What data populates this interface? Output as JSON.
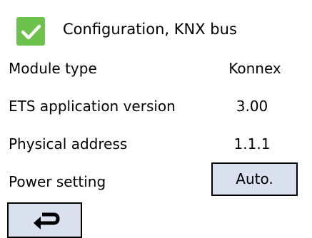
{
  "header": {
    "status_icon": "green-check-icon",
    "title": "Configuration, KNX bus"
  },
  "rows": [
    {
      "label": "Module type",
      "value": "Konnex"
    },
    {
      "label": "ETS application version",
      "value": "3.00"
    },
    {
      "label": "Physical address",
      "value": "1.1.1"
    },
    {
      "label": "Power setting",
      "value": "Auto."
    }
  ],
  "footer": {
    "back_icon": "return-arrow-icon"
  },
  "colors": {
    "accent_green": "#6cc24a",
    "button_fill": "#d9e0ee",
    "border": "#000000",
    "background": "#ffffff"
  }
}
